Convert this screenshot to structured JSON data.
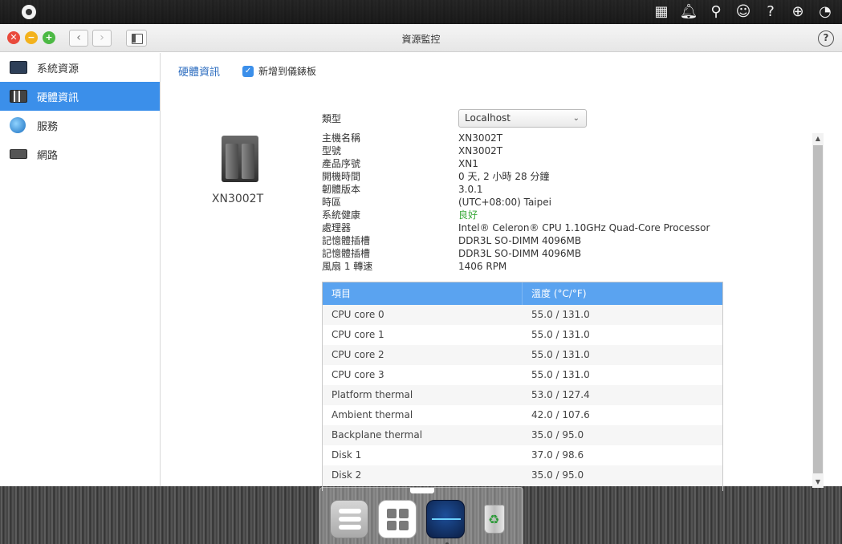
{
  "topbar": {
    "icons": [
      "app-grid-icon",
      "bell-icon",
      "search-icon",
      "user-icon",
      "help-icon",
      "globe-icon",
      "dashboard-icon"
    ]
  },
  "window": {
    "title": "資源監控",
    "controls": {
      "close": "✕",
      "minimize": "−",
      "maximize": "+"
    },
    "nav": {
      "back": "‹",
      "forward": "›"
    },
    "help": "?"
  },
  "sidebar": {
    "items": [
      {
        "label": "系統資源",
        "icon": "chart-icon",
        "active": false
      },
      {
        "label": "硬體資訊",
        "icon": "hardware-icon",
        "active": true
      },
      {
        "label": "服務",
        "icon": "service-icon",
        "active": false
      },
      {
        "label": "網路",
        "icon": "network-icon",
        "active": false
      }
    ]
  },
  "main": {
    "tab": "硬體資訊",
    "add_to_dashboard": {
      "label": "新增到儀錶板",
      "checked": true
    },
    "device_name": "XN3002T",
    "type": {
      "label": "類型",
      "value": "Localhost"
    },
    "info": [
      {
        "key": "主機名稱",
        "value": "XN3002T"
      },
      {
        "key": "型號",
        "value": "XN3002T"
      },
      {
        "key": "產品序號",
        "value": "XN1"
      },
      {
        "key": "開機時間",
        "value": "0 天, 2 小時 28 分鐘"
      },
      {
        "key": "韌體版本",
        "value": "3.0.1"
      },
      {
        "key": "時區",
        "value": "(UTC+08:00) Taipei"
      },
      {
        "key": "系統健康",
        "value": "良好"
      },
      {
        "key": "處理器",
        "value": "Intel® Celeron® CPU 1.10GHz Quad-Core Processor"
      },
      {
        "key": "記憶體插槽",
        "value": "DDR3L SO-DIMM 4096MB"
      },
      {
        "key": "記憶體插槽",
        "value": "DDR3L SO-DIMM 4096MB"
      },
      {
        "key": "風扇 1 轉速",
        "value": "1406 RPM"
      }
    ],
    "table": {
      "headers": [
        "項目",
        "溫度 (°C/°F)"
      ],
      "rows": [
        [
          "CPU core 0",
          "55.0 / 131.0"
        ],
        [
          "CPU core 1",
          "55.0 / 131.0"
        ],
        [
          "CPU core 2",
          "55.0 / 131.0"
        ],
        [
          "CPU core 3",
          "55.0 / 131.0"
        ],
        [
          "Platform thermal",
          "53.0 / 127.4"
        ],
        [
          "Ambient thermal",
          "42.0 / 107.6"
        ],
        [
          "Backplane thermal",
          "35.0 / 95.0"
        ],
        [
          "Disk 1",
          "37.0 / 98.6"
        ],
        [
          "Disk 2",
          "35.0 / 95.0"
        ]
      ]
    }
  },
  "dock": {
    "apps": [
      "control-panel-icon",
      "app-center-icon",
      "resource-monitor-icon",
      "recycle-bin-icon"
    ]
  },
  "colors": {
    "accent": "#3b8fea",
    "table_header": "#5aa3f0",
    "healthy": "#3aa93a"
  }
}
